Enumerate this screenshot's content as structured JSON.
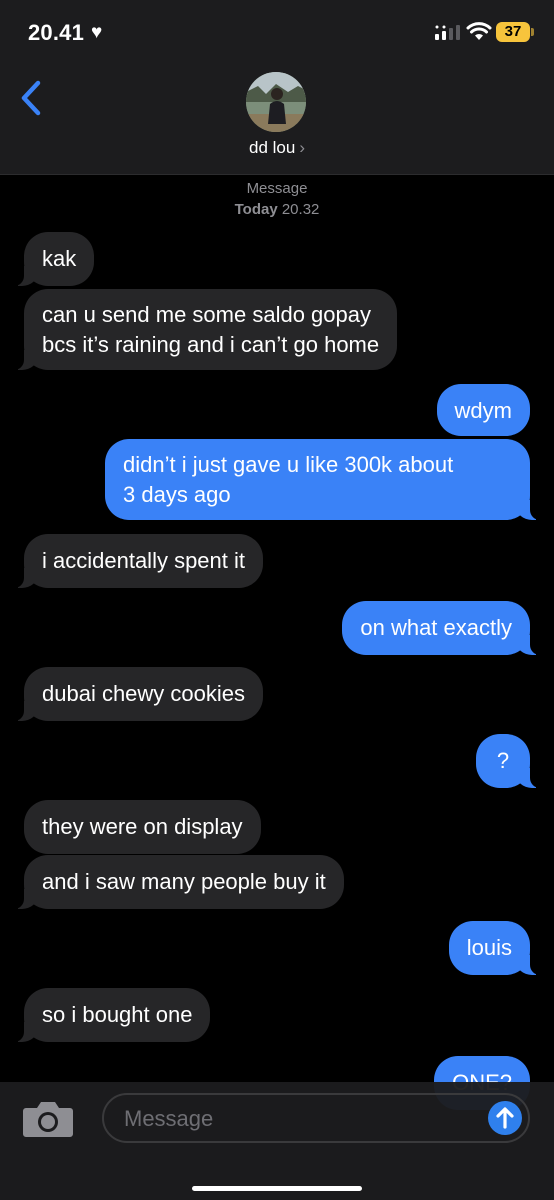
{
  "status_bar": {
    "time": "20.41",
    "battery": "37"
  },
  "header": {
    "contact_name": "dd lou",
    "chevron": "›"
  },
  "thread_meta": {
    "service": "Message",
    "day": "Today",
    "time": "20.32"
  },
  "messages": [
    {
      "from": "them",
      "text": "kak"
    },
    {
      "from": "them",
      "lines": [
        "can u send me some saldo gopay",
        "bcs it’s raining and i can’t go home"
      ]
    },
    {
      "from": "me",
      "text": "wdym"
    },
    {
      "from": "me",
      "lines": [
        "didn’t i just gave u like 300k about",
        "3 days ago"
      ]
    },
    {
      "from": "them",
      "text": "i accidentally spent it"
    },
    {
      "from": "me",
      "text": "on what exactly"
    },
    {
      "from": "them",
      "text": "dubai chewy cookies"
    },
    {
      "from": "me",
      "text": "?"
    },
    {
      "from": "them",
      "text": "they were on display"
    },
    {
      "from": "them",
      "text": "and i saw many people buy it"
    },
    {
      "from": "me",
      "text": "louis"
    },
    {
      "from": "them",
      "text": "so i bought one"
    },
    {
      "from": "me",
      "text": "ONE?"
    }
  ],
  "composer": {
    "placeholder": "Message"
  },
  "colors": {
    "sent_bubble": "#3a82f7",
    "received_bubble": "#262628",
    "background": "#000000",
    "battery": "#f7c43c"
  },
  "icons": [
    "back-chevron-icon",
    "camera-icon",
    "send-arrow-icon",
    "heart-icon",
    "signal-icon",
    "wifi-icon"
  ]
}
